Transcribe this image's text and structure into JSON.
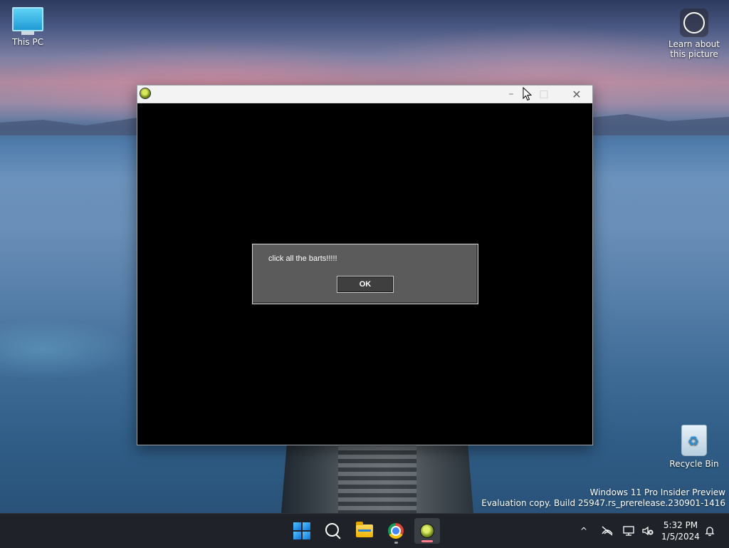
{
  "desktop": {
    "icons": {
      "this_pc": "This PC",
      "learn": "Learn about this picture",
      "recycle_bin": "Recycle Bin"
    },
    "watermark": {
      "line1": "Windows 11 Pro Insider Preview",
      "line2": "Evaluation copy. Build 25947.rs_prerelease.230901-1416"
    }
  },
  "window": {
    "title_icon": "game-gear-icon",
    "controls": {
      "minimize": "–",
      "maximize": "□",
      "close": "✕"
    }
  },
  "dialog": {
    "message": "click all the barts!!!!!",
    "ok_label": "OK"
  },
  "taskbar": {
    "apps": [
      "start-icon",
      "search-icon",
      "file-explorer-icon",
      "chrome-icon",
      "game-app-icon"
    ],
    "tray": {
      "chevron": "^",
      "time": "5:32 PM",
      "date": "1/5/2024"
    }
  },
  "colors": {
    "dialog_bg": "#5b5b5b",
    "window_client": "#000000",
    "taskbar_bg": "#1f2329",
    "start_blue": "#0a74d6"
  }
}
